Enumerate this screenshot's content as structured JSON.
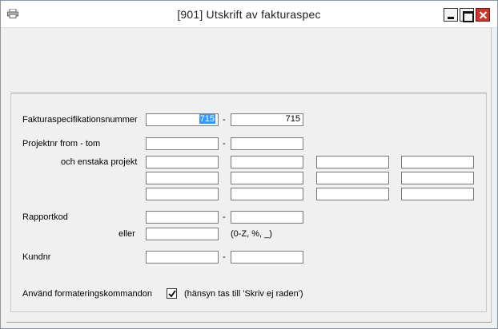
{
  "window": {
    "title": "[901]  Utskrift av fakturaspec"
  },
  "form": {
    "fakturaspec": {
      "label": "Fakturaspecifikationsnummer",
      "from": "715",
      "separator": "-",
      "to": "715"
    },
    "projekt": {
      "label": "Projektnr from - tom",
      "separator": "-",
      "from": "",
      "to": "",
      "single_label": "och enstaka projekt",
      "single_values": [
        "",
        "",
        "",
        "",
        "",
        "",
        "",
        "",
        "",
        "",
        "",
        ""
      ]
    },
    "rapportkod": {
      "label": "Rapportkod",
      "separator": "-",
      "from": "",
      "to": "",
      "or_label": "eller",
      "pattern_value": "",
      "pattern_hint": "(0-Z, %, _)"
    },
    "kundnr": {
      "label": "Kundnr",
      "separator": "-",
      "from": "",
      "to": ""
    },
    "formatering": {
      "label": "Använd formateringskommandon",
      "checked": true,
      "hint": "(hänsyn tas till 'Skriv ej raden')"
    }
  },
  "icons": {
    "app": "printer-icon",
    "minimize": "minimize-icon",
    "maximize": "maximize-icon",
    "close": "close-icon",
    "check": "checkmark-icon"
  },
  "colors": {
    "selection": "#3399ff",
    "close_button": "#c8372d",
    "window_bg": "#f0f0f0"
  }
}
